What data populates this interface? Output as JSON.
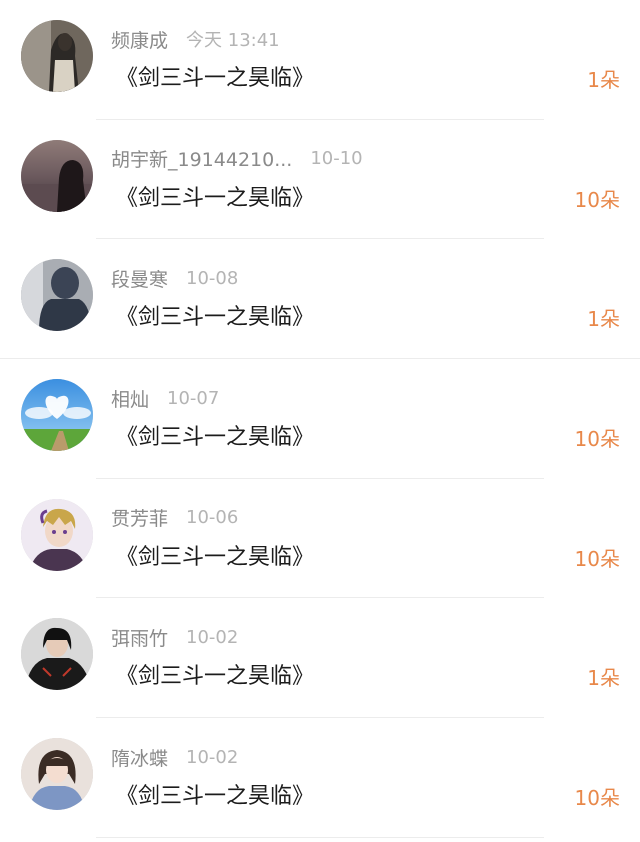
{
  "accent_color": "#e8884a",
  "rows": [
    {
      "name": "频康成",
      "time": "今天 13:41",
      "gift": "《剑三斗一之昊临》",
      "amount": "1朵",
      "avatar": "photo-of-person-icon"
    },
    {
      "name": "胡宇新_19144210...",
      "time": "10-10",
      "gift": "《剑三斗一之昊临》",
      "amount": "10朵",
      "avatar": "silhouette-at-sunset-icon"
    },
    {
      "name": "段曼寒",
      "time": "10-08",
      "gift": "《剑三斗一之昊临》",
      "amount": "1朵",
      "avatar": "hooded-person-icon"
    },
    {
      "name": "相灿",
      "time": "10-07",
      "gift": "《剑三斗一之昊临》",
      "amount": "10朵",
      "avatar": "heart-cloud-sky-icon"
    },
    {
      "name": "贯芳菲",
      "time": "10-06",
      "gift": "《剑三斗一之昊临》",
      "amount": "10朵",
      "avatar": "anime-boy-icon"
    },
    {
      "name": "弭雨竹",
      "time": "10-02",
      "gift": "《剑三斗一之昊临》",
      "amount": "1朵",
      "avatar": "game-character-icon"
    },
    {
      "name": "隋冰蝶",
      "time": "10-02",
      "gift": "《剑三斗一之昊临》",
      "amount": "10朵",
      "avatar": "girl-portrait-icon"
    }
  ]
}
